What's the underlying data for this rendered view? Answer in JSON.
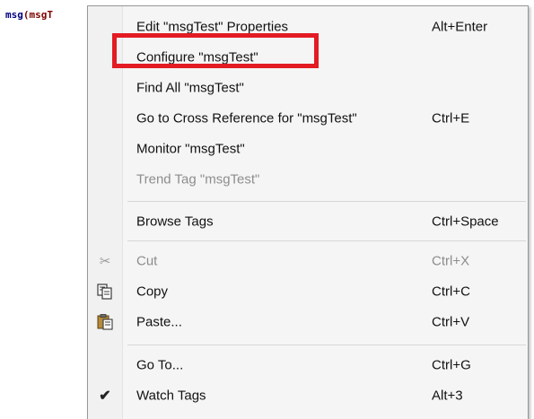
{
  "code": {
    "fn": "msg",
    "paren": "(",
    "arg_partial": "msgT"
  },
  "menu": {
    "items": [
      {
        "label": "Edit \"msgTest\" Properties",
        "shortcut": "Alt+Enter"
      },
      {
        "label": "Configure \"msgTest\"",
        "shortcut": ""
      },
      {
        "label": "Find All \"msgTest\"",
        "shortcut": ""
      },
      {
        "label": "Go to Cross Reference for \"msgTest\"",
        "shortcut": "Ctrl+E"
      },
      {
        "label": "Monitor \"msgTest\"",
        "shortcut": ""
      },
      {
        "label": "Trend Tag \"msgTest\"",
        "shortcut": "",
        "disabled": true
      },
      {
        "label": "Browse Tags",
        "shortcut": "Ctrl+Space"
      },
      {
        "label": "Cut",
        "shortcut": "Ctrl+X",
        "disabled": true,
        "icon": "scissors-icon"
      },
      {
        "label": "Copy",
        "shortcut": "Ctrl+C",
        "icon": "copy-icon"
      },
      {
        "label": "Paste...",
        "shortcut": "Ctrl+V",
        "icon": "paste-icon"
      },
      {
        "label": "Go To...",
        "shortcut": "Ctrl+G"
      },
      {
        "label": "Watch Tags",
        "shortcut": "Alt+3",
        "checked": true,
        "icon": "checkmark-icon"
      }
    ]
  },
  "colors": {
    "highlight": "#e31b23",
    "disabled_text": "#8d8d8d"
  }
}
